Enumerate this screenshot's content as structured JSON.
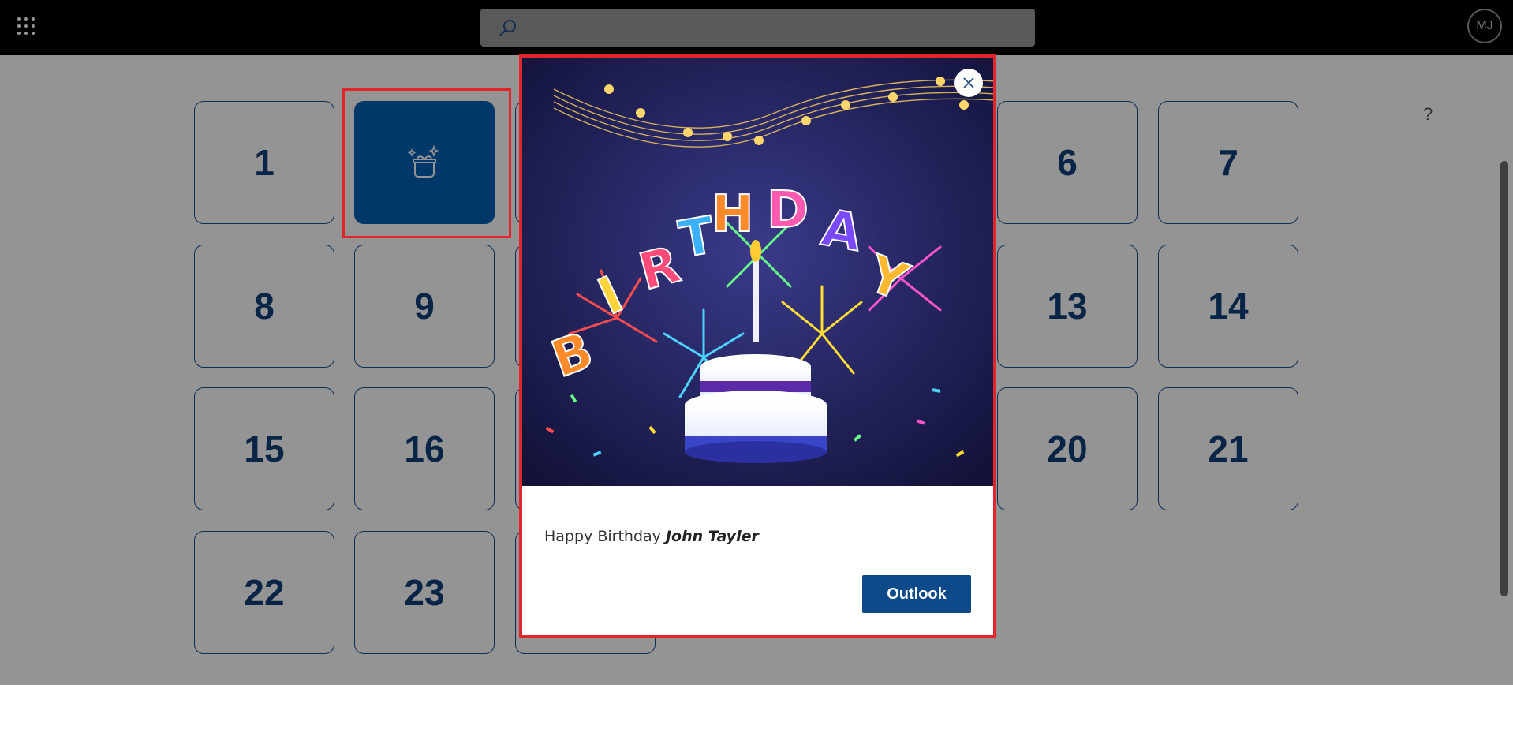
{
  "header": {
    "search_placeholder": "",
    "avatar_initials": "MJ"
  },
  "help_label": "?",
  "calendar": {
    "tiles": [
      {
        "label": "1"
      },
      {
        "label": "",
        "icon": "gift-box-sparkles-icon",
        "active": true
      },
      {
        "label": "6"
      },
      {
        "label": "7"
      },
      {
        "label": "8"
      },
      {
        "label": "9"
      },
      {
        "label": "13"
      },
      {
        "label": "14"
      },
      {
        "label": "15"
      },
      {
        "label": "16"
      },
      {
        "label": "20"
      },
      {
        "label": "21"
      },
      {
        "label": "22"
      },
      {
        "label": "23"
      }
    ]
  },
  "modal": {
    "image_icon": "happy-birthday-cake-fireworks-image",
    "message_prefix": "Happy Birthday ",
    "message_name": "John Tayler",
    "primary_button": "Outlook",
    "close_icon": "close-icon"
  },
  "colors": {
    "tile_border": "#15508f",
    "tile_text": "#0e3f7a",
    "active_tile": "#0062b5",
    "highlight_outline": "#e0262a",
    "button_bg": "#0e4a8a"
  }
}
